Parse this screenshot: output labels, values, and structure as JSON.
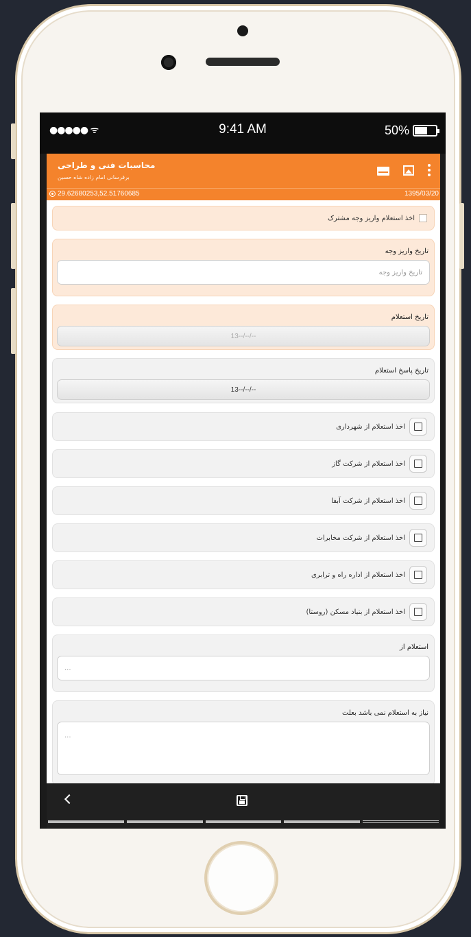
{
  "status_bar": {
    "signal": "●●●●● ᯤ",
    "time": "9:41 AM",
    "battery": "50%"
  },
  "app_bar": {
    "title": "محاسبات فنی و طراحی",
    "subtitle": "برقرسانی امام زاده شاه حسین"
  },
  "info_bar": {
    "coordinates": "29.62680253,52.51760685",
    "date": "1395/03/20"
  },
  "form": {
    "shared_payment_checkbox": "اخذ استعلام واریز وجه مشترک",
    "payment_date": {
      "label": "تاریخ واریز وجه",
      "placeholder": "تاریخ واریز وجه"
    },
    "inquiry_date": {
      "label": "تاریخ استعلام",
      "value": "13--/--/--"
    },
    "inquiry_reply_date": {
      "label": "تاریخ پاسخ استعلام",
      "value": "13--/--/--"
    },
    "checkboxes": [
      "اخذ استعلام از شهرداری",
      "اخذ استعلام از شرکت گاز",
      "اخذ استعلام از شرکت آبفا",
      "اخذ استعلام از شرکت مخابرات",
      "اخذ استعلام از اداره راه و ترابری",
      "اخذ استعلام از بنیاد مسکن (روستا)"
    ],
    "inquiry_from": {
      "label": "استعلام از",
      "placeholder": "..."
    },
    "no_inquiry_reason": {
      "label": "نیاز به استعلام نمی باشد بعلت",
      "placeholder": "..."
    }
  },
  "colors": {
    "accent": "#f4832c",
    "peach_card": "#fde9d9",
    "grey_card": "#f2f2f2"
  },
  "icons": {
    "back": "chevron-left-icon",
    "save": "save-icon",
    "mail": "mail-icon",
    "image": "image-icon",
    "menu": "more-vert-icon",
    "location": "location-icon"
  }
}
